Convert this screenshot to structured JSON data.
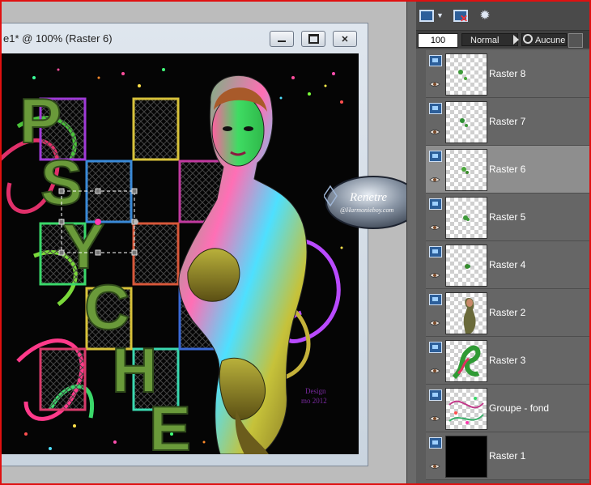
{
  "document": {
    "title": "e1* @ 100% (Raster 6)",
    "minimize_label": "—",
    "restore_label": "□",
    "close_label": "✕"
  },
  "artwork": {
    "letters": [
      "P",
      "S",
      "Y",
      "C",
      "H",
      "E"
    ],
    "signature_line1": "Design",
    "signature_line2": "mo 2012"
  },
  "watermark": {
    "text1": "Renetre",
    "text2": "@Harmonieboy.com"
  },
  "layer_toolbar": {
    "opacity": "100",
    "blend_mode": "Normal",
    "lock_mode": "Aucune"
  },
  "layers": [
    {
      "name": "Raster 8",
      "thumb": "checker-small",
      "selected": false
    },
    {
      "name": "Raster 7",
      "thumb": "checker-small",
      "selected": false
    },
    {
      "name": "Raster 6",
      "thumb": "checker-small",
      "selected": true
    },
    {
      "name": "Raster 5",
      "thumb": "checker-small",
      "selected": false
    },
    {
      "name": "Raster 4",
      "thumb": "checker-small",
      "selected": false
    },
    {
      "name": "Raster 2",
      "thumb": "woman",
      "selected": false
    },
    {
      "name": "Raster 3",
      "thumb": "swirl",
      "selected": false
    },
    {
      "name": "Groupe - fond",
      "thumb": "group",
      "selected": false
    },
    {
      "name": "Raster 1",
      "thumb": "black",
      "selected": false
    }
  ],
  "colors": {
    "selection_red": "#e01010",
    "selected_layer": "#8e8e8e",
    "layer_bg": "#666666",
    "letter_green": "#6a9a3a"
  }
}
